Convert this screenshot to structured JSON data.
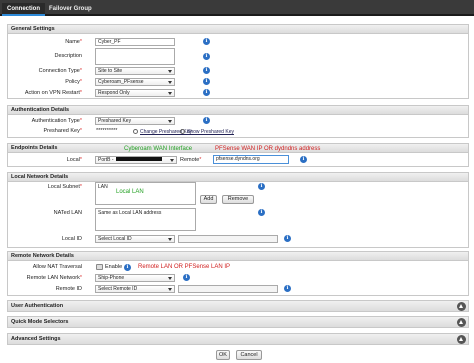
{
  "tabs": {
    "connection": "Connection",
    "failover": "Failover Group"
  },
  "general": {
    "title": "General Settings",
    "name_label": "Name",
    "name_value": "Cyber_PF",
    "description_label": "Description",
    "connection_type_label": "Connection Type",
    "connection_type_value": "Site to Site",
    "policy_label": "Policy",
    "policy_value": "Cyberoam_PFsense",
    "vpn_restart_label": "Action on VPN Restart",
    "vpn_restart_value": "Respond Only",
    "required_mark": "*"
  },
  "auth": {
    "title": "Authentication Details",
    "type_label": "Authentication Type",
    "type_value": "Preshared Key",
    "key_label": "Preshared Key",
    "key_value": "**********",
    "change_link": "Change Preshared Key",
    "show_link": "Show Preshared Key"
  },
  "endpoints": {
    "title": "Endpoints Details",
    "local_label": "Local",
    "local_value": "PortB -",
    "remote_label": "Remote",
    "remote_value": "pfsense.dyndns.org",
    "ann_local": "Cyberoam WAN Interface",
    "ann_remote": "PFSense WAN IP OR dydndns address"
  },
  "local_network": {
    "title": "Local Network Details",
    "subnet_label": "Local Subnet",
    "subnet_value": "LAN",
    "ann_lan": "Local LAN",
    "add_label": "Add",
    "remove_label": "Remove",
    "nated_label": "NATed LAN",
    "nated_value": "Same as Local LAN address",
    "local_id_label": "Local ID",
    "local_id_value": "Select Local ID"
  },
  "remote_network": {
    "title": "Remote Network Details",
    "nat_traversal_label": "Allow NAT Traversal",
    "enable_label": "Enable",
    "remote_lan_label": "Remote LAN Network",
    "remote_lan_value": "Ship-Phone",
    "ann_remote_lan": "Remote LAN OR PFSense LAN IP",
    "remote_id_label": "Remote ID",
    "remote_id_value": "Select Remote ID"
  },
  "collapsed": {
    "user_auth": "User Authentication",
    "quick_mode": "Quick Mode Selectors",
    "advanced": "Advanced Settings"
  },
  "footer": {
    "ok": "OK",
    "cancel": "Cancel"
  },
  "colors": {
    "accent": "#2e8ad8",
    "info": "#2b6fc4",
    "annotation_green": "#22a022",
    "annotation_red": "#d02020"
  }
}
